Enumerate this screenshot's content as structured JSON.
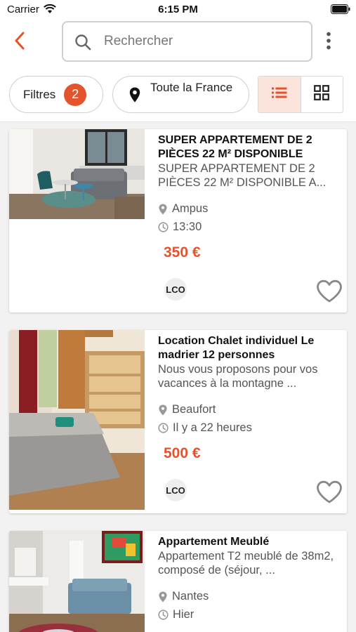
{
  "status_bar": {
    "carrier": "Carrier",
    "time": "6:15 PM"
  },
  "search": {
    "placeholder": "Rechercher",
    "value": ""
  },
  "filters": {
    "label": "Filtres",
    "count": "2"
  },
  "location": {
    "label": "Toute la France"
  },
  "view_mode": {
    "selected": "list",
    "options": [
      "list",
      "grid"
    ]
  },
  "colors": {
    "accent": "#e4532c",
    "accent_light": "#fbe4dc",
    "border": "#cfcfcf",
    "muted_text": "#555555"
  },
  "listings": [
    {
      "title": "SUPER APPARTEMENT DE 2 PIÈCES 22 M² DISPONIBLE",
      "description": "SUPER APPARTEMENT DE 2 PIÈCES 22 M² DISPONIBLE A...",
      "location": "Ampus",
      "time": "13:30",
      "price": "350 €",
      "seller_badge": "LCO"
    },
    {
      "title": "Location Chalet individuel Le madrier 12 personnes",
      "description": "Nous vous proposons pour vos vacances à la montagne ...",
      "location": "Beaufort",
      "time": "Il y a 22 heures",
      "price": "500 €",
      "seller_badge": "LCO"
    },
    {
      "title": "Appartement Meublé",
      "description": "Appartement T2 meublé de 38m2, composé de (séjour, ...",
      "location": "Nantes",
      "time": "Hier"
    }
  ],
  "icons": [
    "wifi-icon",
    "battery-icon",
    "back-arrow-icon",
    "search-icon",
    "more-vertical-icon",
    "map-pin-icon",
    "list-view-icon",
    "grid-view-icon",
    "location-pin-icon",
    "clock-icon",
    "heart-icon"
  ]
}
